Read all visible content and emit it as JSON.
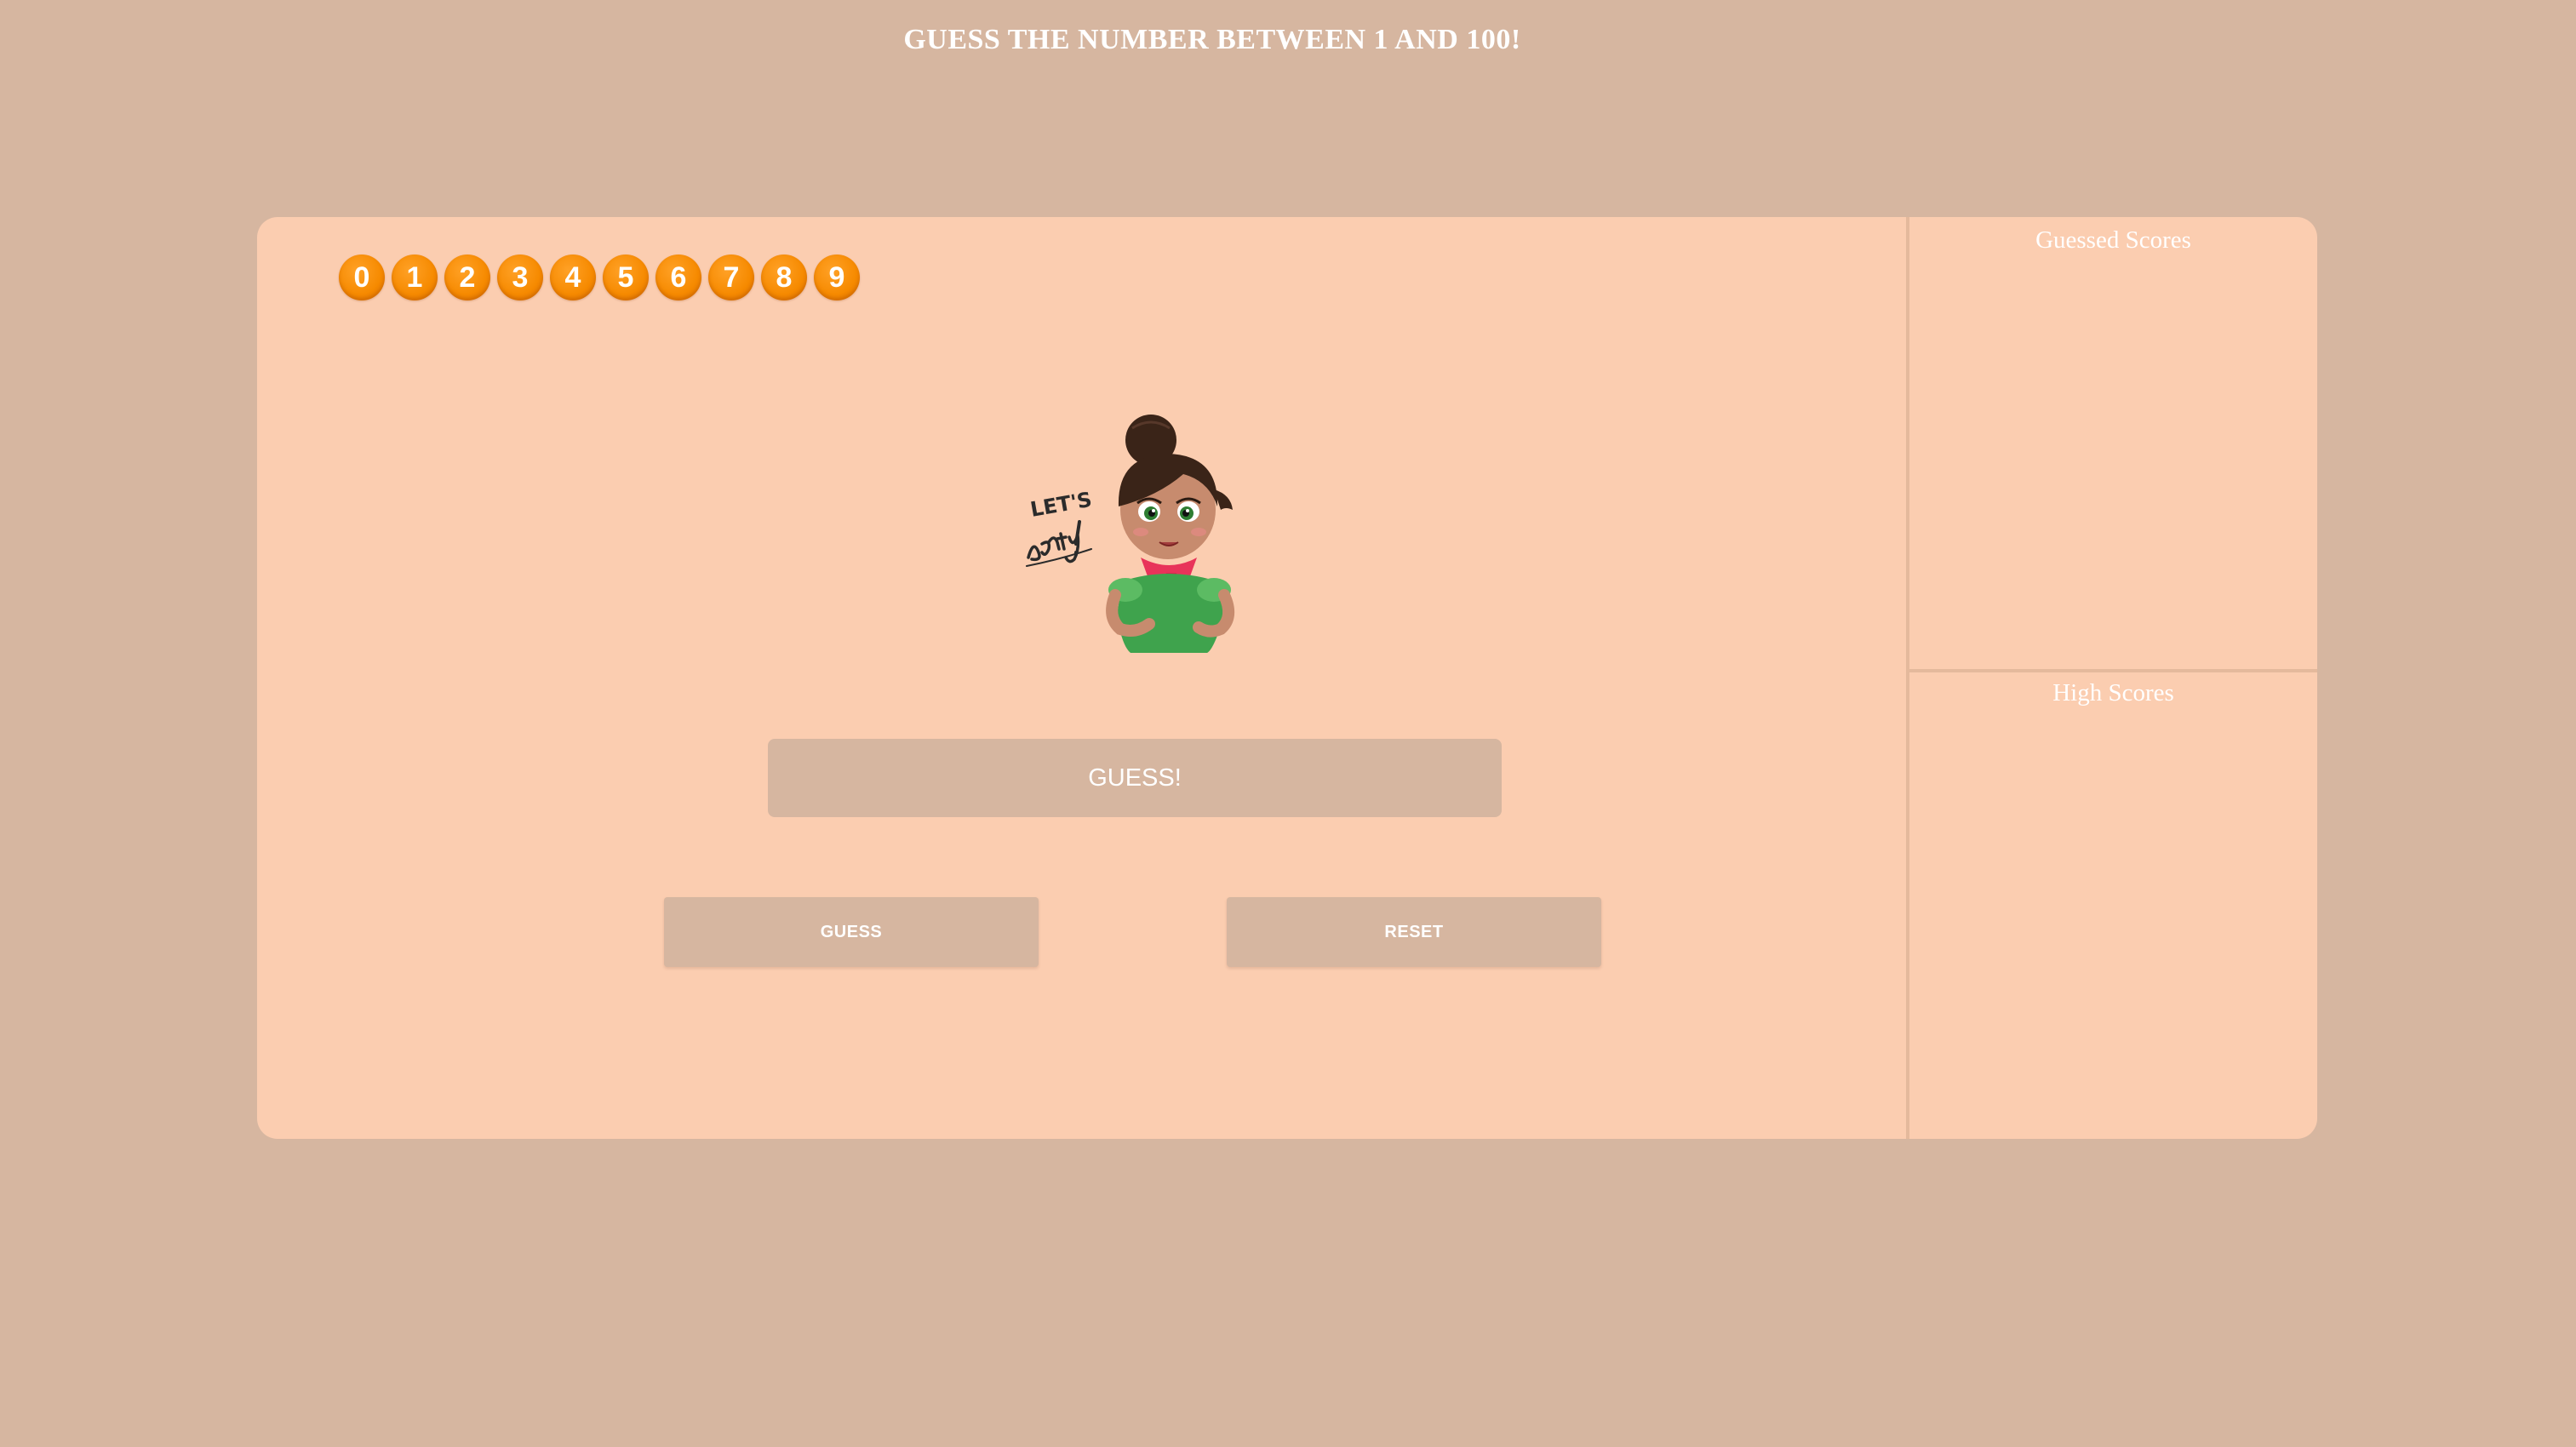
{
  "header": {
    "title": "GUESS THE NUMBER BETWEEN 1 AND 100!"
  },
  "digits": [
    "0",
    "1",
    "2",
    "3",
    "4",
    "5",
    "6",
    "7",
    "8",
    "9"
  ],
  "mascot": {
    "caption": "LET'S party!"
  },
  "guess_display": {
    "value": "GUESS!"
  },
  "buttons": {
    "guess": "GUESS",
    "reset": "RESET"
  },
  "side_panel": {
    "guessed_title": "Guessed Scores",
    "high_title": "High Scores"
  },
  "colors": {
    "background": "#d6b6a0",
    "card": "#fbcdb0",
    "digit_orange": "#f68a00",
    "text": "#ffffff"
  }
}
